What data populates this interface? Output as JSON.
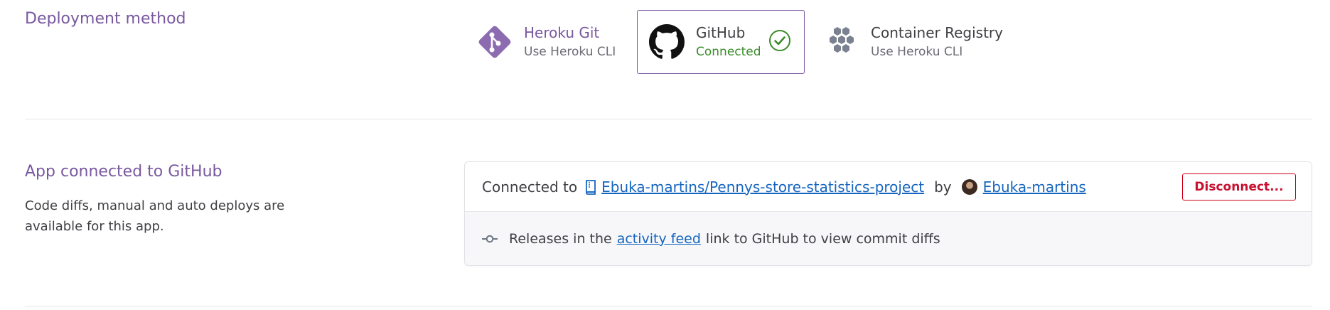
{
  "deployment": {
    "title": "Deployment method",
    "methods": [
      {
        "name": "Heroku Git",
        "sub": "Use Heroku CLI",
        "icon": "heroku-git-icon"
      },
      {
        "name": "GitHub",
        "sub": "Connected",
        "icon": "github-icon",
        "active": true,
        "status_icon": "check-circle-icon"
      },
      {
        "name": "Container Registry",
        "sub": "Use Heroku CLI",
        "icon": "container-registry-icon"
      }
    ]
  },
  "connection": {
    "title": "App connected to GitHub",
    "description": "Code diffs, manual and auto deploys are available for this app.",
    "connected_to_label": "Connected to",
    "repo": "Ebuka-martins/Pennys-store-statistics-project",
    "by_label": "by",
    "user": "Ebuka-martins",
    "disconnect_label": "Disconnect...",
    "releases_prefix": "Releases in the",
    "activity_link": "activity feed",
    "releases_suffix": "link to GitHub to view commit diffs"
  },
  "colors": {
    "accent": "#79589f",
    "connected": "#3a8b2a",
    "link": "#1565c0",
    "danger": "#c8102e"
  }
}
